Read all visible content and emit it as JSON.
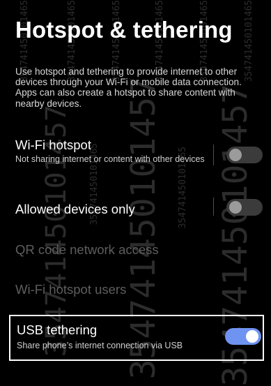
{
  "page": {
    "title": "Hotspot & tethering",
    "description": "Use hotspot and tethering to provide internet to other devices through your Wi-Fi or mobile data connection. Apps can also create a hotspot to share content with nearby devices."
  },
  "settings": [
    {
      "title": "Wi-Fi hotspot",
      "subtitle": "Not sharing internet or content with other devices",
      "toggle": "off"
    },
    {
      "title": "Allowed devices only",
      "toggle": "off"
    },
    {
      "title": "QR code network access",
      "state": "disabled"
    },
    {
      "title": "Wi-Fi hotspot users",
      "state": "disabled"
    },
    {
      "title": "USB tethering",
      "subtitle": "Share phone’s internet connection via USB",
      "toggle": "on"
    }
  ],
  "colors": {
    "background": "#000000",
    "accent": "#6f93f0"
  },
  "watermark": {
    "big": "354741450101457",
    "small": "354741450101465"
  }
}
